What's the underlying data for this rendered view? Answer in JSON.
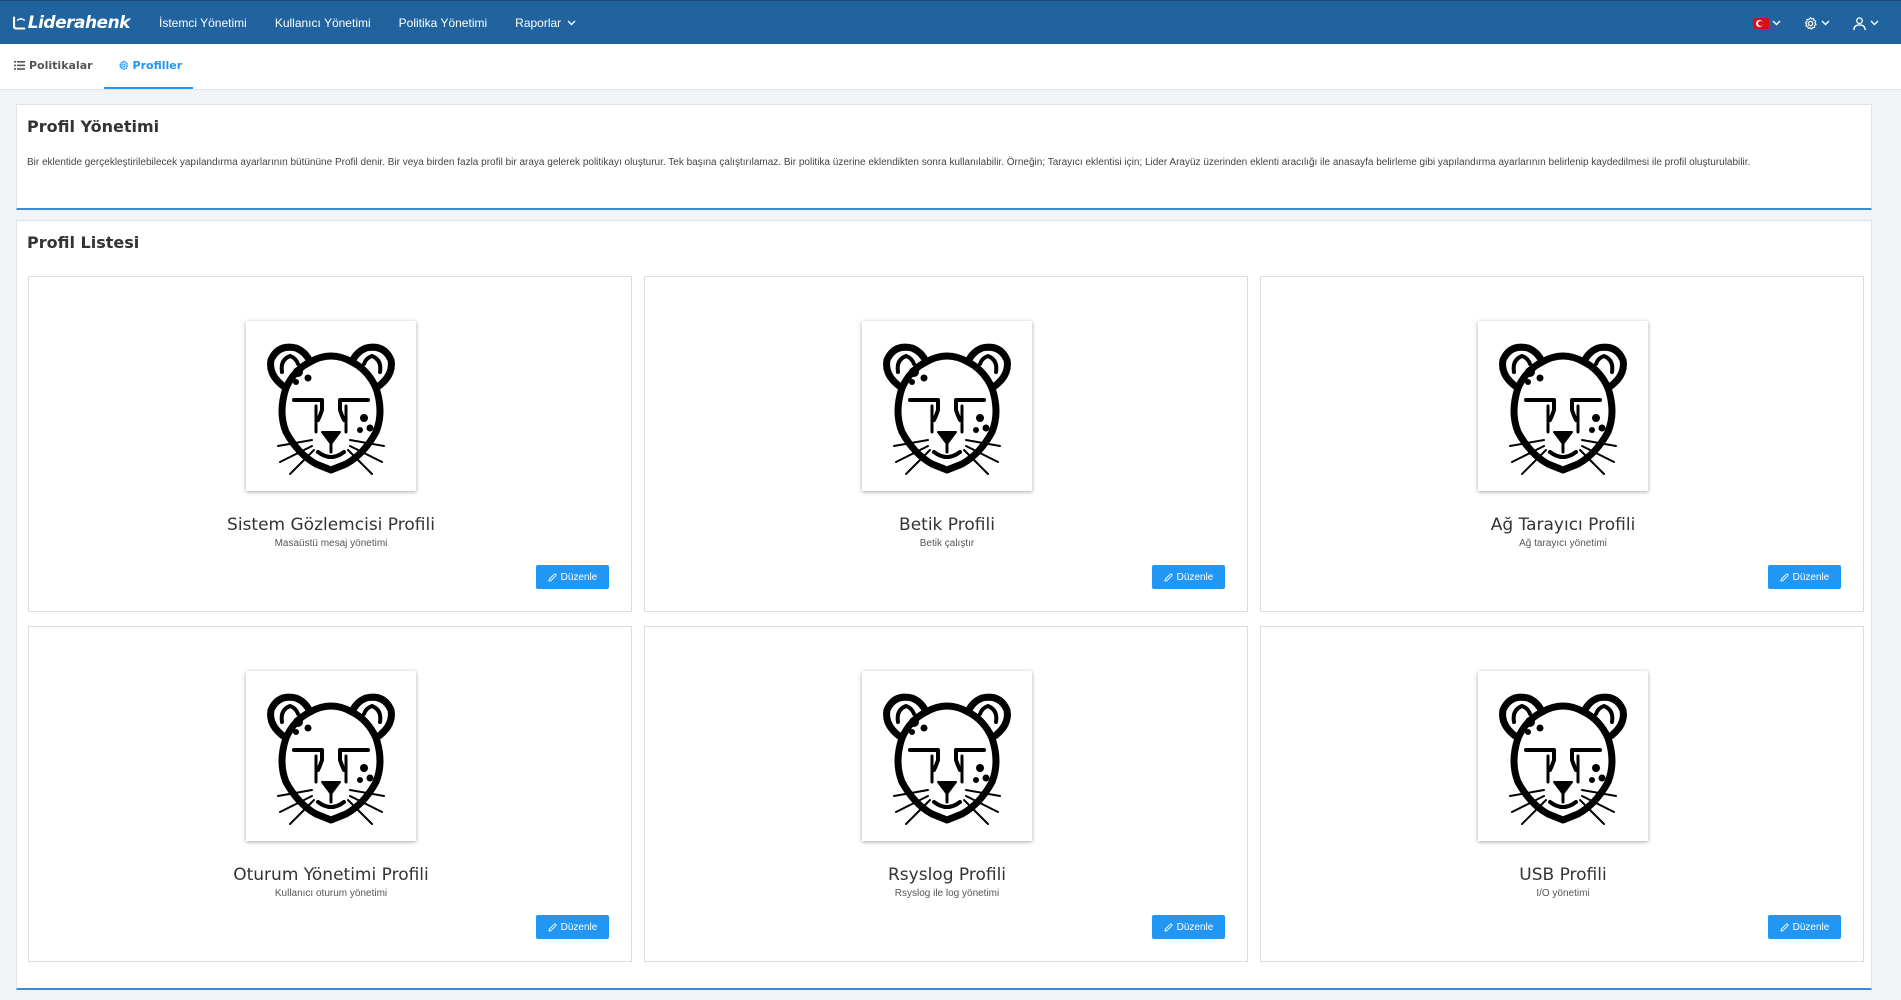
{
  "app": {
    "brand": "Liderahenk"
  },
  "nav": {
    "items": [
      {
        "label": "İstemci Yönetimi"
      },
      {
        "label": "Kullanıcı Yönetimi"
      },
      {
        "label": "Politika Yönetimi"
      },
      {
        "label": "Raporlar",
        "has_dropdown": true
      }
    ],
    "right_icons": [
      "turkish-flag-icon",
      "gear-icon",
      "user-icon"
    ]
  },
  "tabs": [
    {
      "label": "Politikalar",
      "icon": "list-icon",
      "active": false
    },
    {
      "label": "Profiller",
      "icon": "gear-icon",
      "active": true
    }
  ],
  "info": {
    "title": "Profil Yönetimi",
    "text": "Bir eklentide gerçekleştirilebilecek yapılandırma ayarlarının bütününe Profil denir. Bir veya birden fazla profil bir araya gelerek politikayı oluşturur. Tek başına çalıştırılamaz. Bir politika üzerine eklendikten sonra kullanılabilir. Örneğin; Tarayıcı eklentisi için; Lider Arayüz üzerinden eklenti aracılığı ile anasayfa belirleme gibi yapılandırma ayarlarının belirlenip kaydedilmesi ile profil oluşturulabilir."
  },
  "profiles": {
    "title": "Profil Listesi",
    "edit_label": "Düzenle",
    "items": [
      {
        "name": "Sistem Gözlemcisi Profili",
        "desc": "Masaüstü mesaj yönetimi"
      },
      {
        "name": "Betik Profili",
        "desc": "Betik çalıştır"
      },
      {
        "name": "Ağ Tarayıcı Profili",
        "desc": "Ağ tarayıcı yönetimi"
      },
      {
        "name": "Oturum Yönetimi Profili",
        "desc": "Kullanıcı oturum yönetimi"
      },
      {
        "name": "Rsyslog Profili",
        "desc": "Rsyslog ile log yönetimi"
      },
      {
        "name": "USB Profili",
        "desc": "I/O yönetimi"
      }
    ]
  },
  "colors": {
    "navbar": "#21639f",
    "accent": "#2196f3",
    "background": "#f1f4f7"
  }
}
